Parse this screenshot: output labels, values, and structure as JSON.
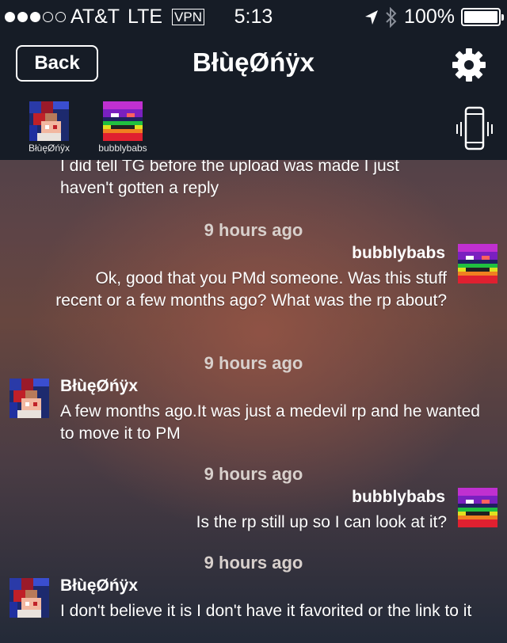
{
  "status_bar": {
    "carrier": "AT&T",
    "network": "LTE",
    "vpn": "VPN",
    "time": "5:13",
    "battery": "100%",
    "signal_bars_filled": 3,
    "signal_bars_total": 5
  },
  "nav": {
    "back_label": "Back",
    "title": "BłùęØńÿx"
  },
  "participants": [
    {
      "name": "BłùęØńÿx",
      "avatar": "blue-onyx-avatar"
    },
    {
      "name": "bubblybabs",
      "avatar": "bubblybabs-avatar"
    }
  ],
  "messages": [
    {
      "type": "continuation",
      "text": "I did tell TG before the upload was made I just haven't gotten a reply"
    },
    {
      "type": "timestamp",
      "text": "9 hours ago"
    },
    {
      "type": "outgoing",
      "sender": "bubblybabs",
      "text": "Ok, good that you PMd someone.  Was this stuff recent or a few months ago?  What was the rp about?"
    },
    {
      "type": "timestamp",
      "text": "9 hours ago"
    },
    {
      "type": "incoming",
      "sender": "BłùęØńÿx",
      "text": "A few months ago.It was just a medevil rp and he wanted to move it to PM"
    },
    {
      "type": "timestamp",
      "text": "9 hours ago"
    },
    {
      "type": "outgoing",
      "sender": "bubblybabs",
      "text": "Is the rp still up so I can look at it?"
    },
    {
      "type": "timestamp",
      "text": "9 hours ago"
    },
    {
      "type": "incoming",
      "sender": "BłùęØńÿx",
      "text": "I don't believe it is I don't have it favorited or the link to it"
    }
  ],
  "colors": {
    "bar_background": "#161c26",
    "timestamp": "#d8d0cc",
    "text": "#ffffff"
  }
}
